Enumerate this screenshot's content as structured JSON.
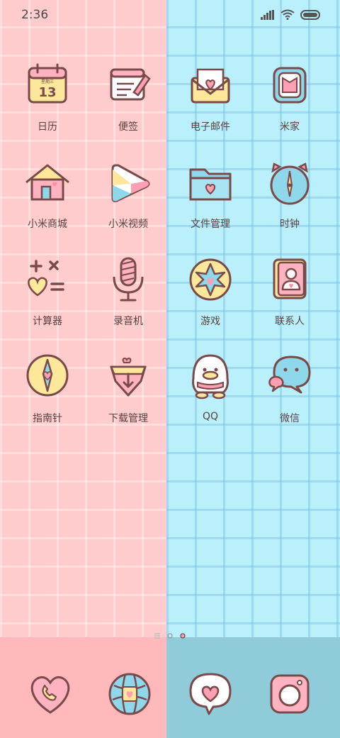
{
  "status_bar": {
    "time": "2:36",
    "icons": [
      "signal-icon",
      "wifi-icon",
      "battery-icon"
    ]
  },
  "apps": [
    {
      "label": "日历",
      "icon": "calendar-icon",
      "day": "13",
      "weekday": "星期三"
    },
    {
      "label": "便签",
      "icon": "notes-icon"
    },
    {
      "label": "电子邮件",
      "icon": "mail-icon"
    },
    {
      "label": "米家",
      "icon": "mijia-icon"
    },
    {
      "label": "小米商城",
      "icon": "house-icon"
    },
    {
      "label": "小米视频",
      "icon": "video-icon"
    },
    {
      "label": "文件管理",
      "icon": "folder-icon"
    },
    {
      "label": "时钟",
      "icon": "clock-icon"
    },
    {
      "label": "计算器",
      "icon": "calculator-icon"
    },
    {
      "label": "录音机",
      "icon": "microphone-icon"
    },
    {
      "label": "游戏",
      "icon": "game-star-icon"
    },
    {
      "label": "联系人",
      "icon": "contacts-icon"
    },
    {
      "label": "指南针",
      "icon": "compass-icon"
    },
    {
      "label": "下载管理",
      "icon": "download-icon"
    },
    {
      "label": "QQ",
      "icon": "qq-penguin-icon"
    },
    {
      "label": "微信",
      "icon": "wechat-icon"
    }
  ],
  "page_indicator": {
    "count": 3,
    "active_index": 2
  },
  "dock": [
    {
      "icon": "phone-icon"
    },
    {
      "icon": "browser-globe-icon"
    },
    {
      "icon": "messages-icon"
    },
    {
      "icon": "camera-icon"
    }
  ],
  "colors": {
    "left_bg": "#ffcccd",
    "right_bg": "#b9f0fb",
    "stroke": "#7a4a4a",
    "yellow": "#fde79a",
    "pink": "#ff9fb3",
    "blue": "#8fd7ea"
  }
}
